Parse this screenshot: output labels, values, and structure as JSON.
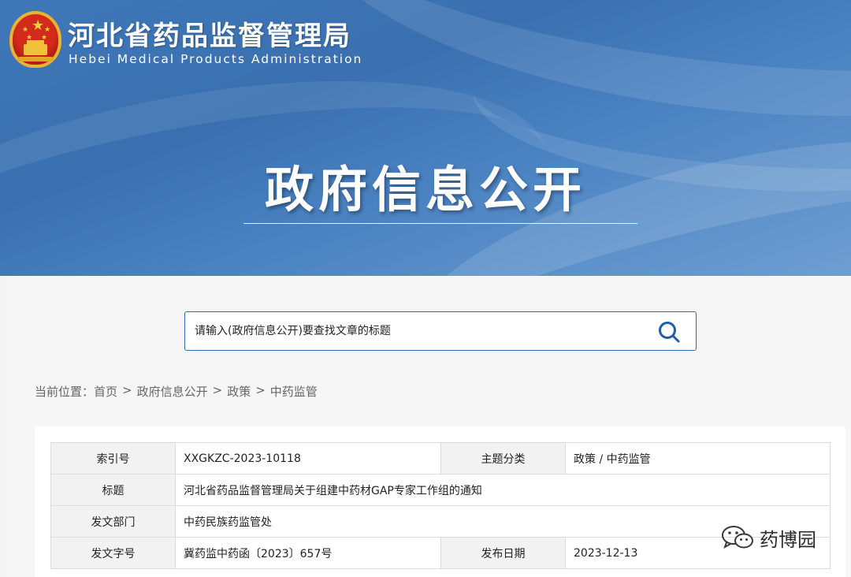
{
  "header": {
    "title_cn": "河北省药品监督管理局",
    "title_en": "Hebei Medical Products Administration",
    "section_title": "政府信息公开"
  },
  "search": {
    "placeholder": "请输入(政府信息公开)要查找文章的标题"
  },
  "breadcrumb": {
    "prefix": "当前位置：",
    "items": [
      "首页",
      "政府信息公开",
      "政策",
      "中药监管"
    ],
    "separator": ">"
  },
  "meta_table": {
    "index_label": "索引号",
    "index_value": "XXGKZC-2023-10118",
    "topic_label": "主题分类",
    "topic_value": "政策 / 中药监管",
    "title_label": "标题",
    "title_value": "河北省药品监督管理局关于组建中药材GAP专家工作组的通知",
    "dept_label": "发文部门",
    "dept_value": "中药民族药监管处",
    "docno_label": "发文字号",
    "docno_value": "冀药监中药函〔2023〕657号",
    "date_label": "发布日期",
    "date_value": "2023-12-13"
  },
  "watermark": {
    "text": "药博园",
    "icon": "wechat-icon"
  },
  "colors": {
    "banner": "#3f77b8",
    "search_border": "#2d6bb0",
    "label_bg": "#f2f2f2"
  }
}
